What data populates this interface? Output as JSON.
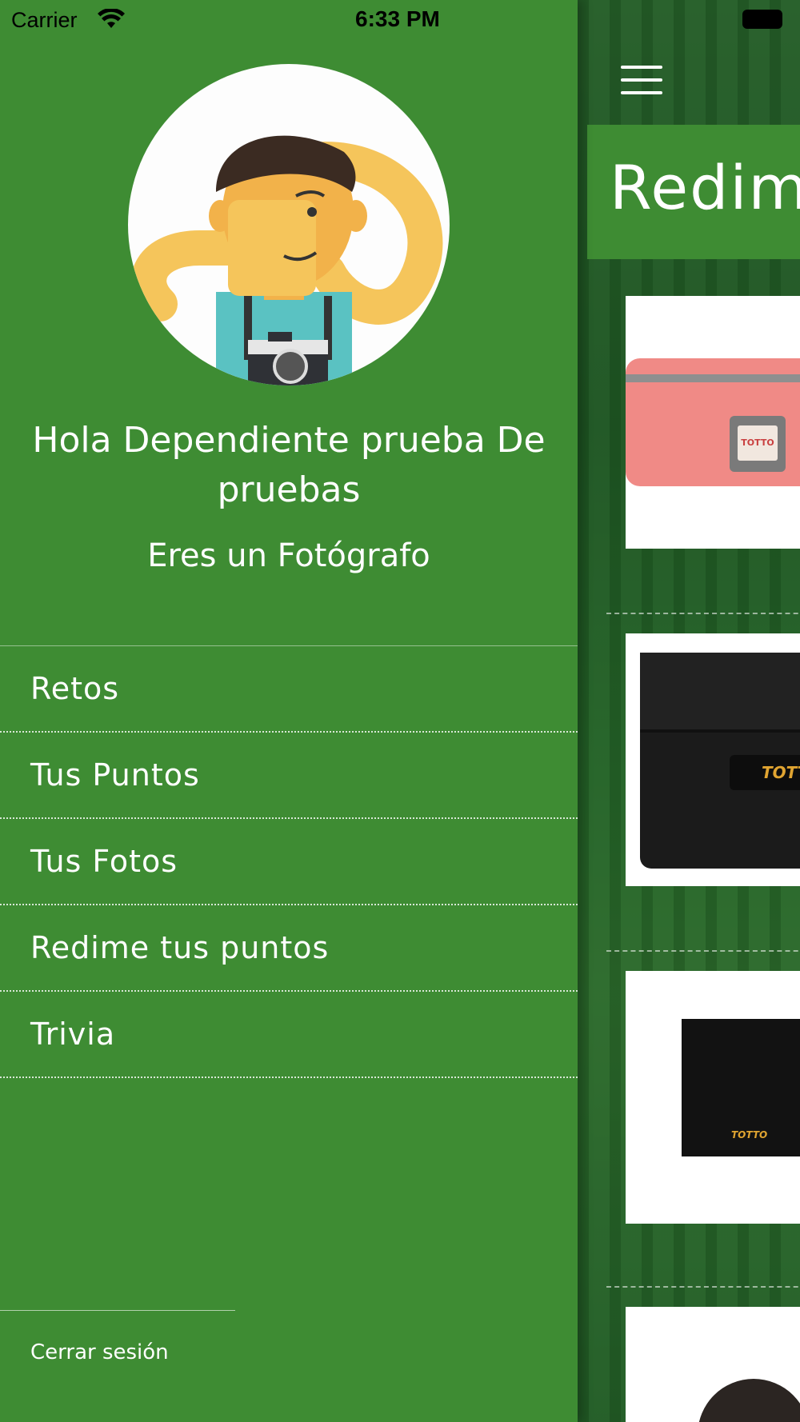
{
  "status_bar": {
    "carrier": "Carrier",
    "time": "6:33 PM"
  },
  "drawer": {
    "greeting": "Hola Dependiente prueba De pruebas",
    "role": "Eres un Fotógrafo",
    "menu": [
      {
        "label": "Retos"
      },
      {
        "label": "Tus Puntos"
      },
      {
        "label": "Tus Fotos"
      },
      {
        "label": "Redime tus puntos"
      },
      {
        "label": "Trivia"
      }
    ],
    "logout_label": "Cerrar sesión"
  },
  "background_screen": {
    "title": "Redim",
    "card_logos": [
      "TOTTO",
      "TOTTO",
      "TOTTO"
    ]
  },
  "colors": {
    "drawer_bg": "#3e8c33",
    "text": "#ffffff"
  }
}
